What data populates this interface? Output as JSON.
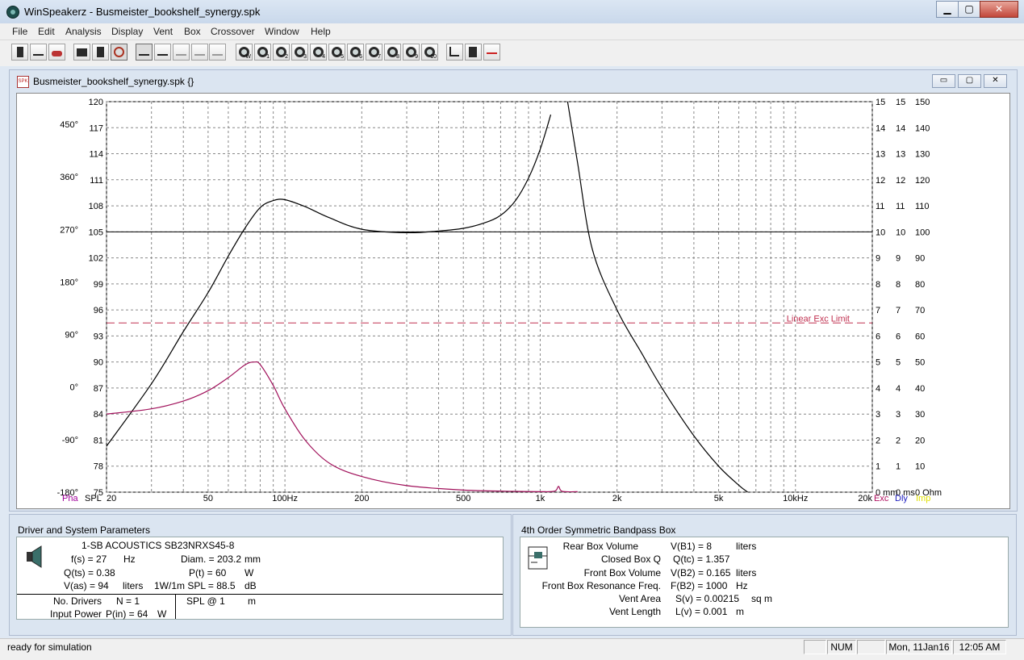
{
  "window": {
    "title": "WinSpeakerz - Busmeister_bookshelf_synergy.spk"
  },
  "menu": [
    "File",
    "Edit",
    "Analysis",
    "Display",
    "Vent",
    "Box",
    "Crossover",
    "Window",
    "Help"
  ],
  "toolbar": {
    "left_group": [
      "speaker-icon",
      "step-icon",
      "car-icon"
    ],
    "group2": [
      "bars-icon",
      "box-icon",
      "impedance-icon"
    ],
    "curve_group": [
      "curve-1-icon",
      "curve-2-icon",
      "curve-3-icon",
      "curve-4-icon"
    ],
    "driver_buttons": [
      "W",
      "1",
      "2",
      "3",
      "4",
      "5",
      "6",
      "7",
      "8",
      "9",
      "10"
    ],
    "right_group": [
      "graph-icon",
      "print-icon",
      "crossover-icon"
    ]
  },
  "document": {
    "title": "Busmeister_bookshelf_synergy.spk {}"
  },
  "chart_data": {
    "type": "line",
    "x_scale": "log",
    "xlim": [
      20,
      20000
    ],
    "x_ticks": [
      {
        "v": 20,
        "label": "20"
      },
      {
        "v": 50,
        "label": "50"
      },
      {
        "v": 100,
        "label": "100Hz"
      },
      {
        "v": 200,
        "label": "200"
      },
      {
        "v": 500,
        "label": "500"
      },
      {
        "v": 1000,
        "label": "1k"
      },
      {
        "v": 2000,
        "label": "2k"
      },
      {
        "v": 5000,
        "label": "5k"
      },
      {
        "v": 10000,
        "label": "10kHz"
      },
      {
        "v": 20000,
        "label": "20k"
      }
    ],
    "spl_ticks": [
      "120",
      "117",
      "114",
      "111",
      "108",
      "105",
      "102",
      "99",
      "96",
      "93",
      "90",
      "87",
      "84",
      "81",
      "78",
      "75"
    ],
    "spl_lim": [
      75,
      120
    ],
    "phase_ticks": [
      "450°",
      "360°",
      "270°",
      "180°",
      "90°",
      "0°",
      "-90°",
      "-180°"
    ],
    "exc_ticks": [
      "15",
      "14",
      "13",
      "12",
      "11",
      "10",
      "9",
      "8",
      "7",
      "6",
      "5",
      "4",
      "3",
      "2",
      "1",
      "0 mm"
    ],
    "dly_ticks": [
      "15",
      "14",
      "13",
      "12",
      "11",
      "10",
      "9",
      "8",
      "7",
      "6",
      "5",
      "4",
      "3",
      "2",
      "1",
      "0 ms"
    ],
    "imp_ticks": [
      "150",
      "140",
      "130",
      "120",
      "110",
      "100",
      "90",
      "80",
      "70",
      "60",
      "50",
      "40",
      "30",
      "20",
      "10",
      "0 Ohm"
    ],
    "left_labels": {
      "pha": "Pha",
      "spl": "SPL"
    },
    "right_labels": {
      "exc": "Exc",
      "dly": "Dly",
      "imp": "Imp"
    },
    "colors": {
      "spl": "#000000",
      "excursion": "#a0105a",
      "linear_limit": "#c03050",
      "pha_label": "#a0009a",
      "dly_label": "#2020c0",
      "imp_label": "#e0e000",
      "exc_label": "#b01060"
    },
    "reference_line_spl": 105,
    "linear_exc_limit": {
      "label": "Linear Exc Limit",
      "value_mm": 6.5
    },
    "series": [
      {
        "name": "SPL",
        "unit": "dB",
        "points": [
          [
            20,
            80.3
          ],
          [
            30,
            87.5
          ],
          [
            40,
            93.5
          ],
          [
            50,
            98
          ],
          [
            60,
            102.2
          ],
          [
            70,
            105.5
          ],
          [
            80,
            107.8
          ],
          [
            90,
            108.6
          ],
          [
            100,
            108.7
          ],
          [
            120,
            107.9
          ],
          [
            150,
            106.6
          ],
          [
            200,
            105.3
          ],
          [
            300,
            104.9
          ],
          [
            400,
            105.1
          ],
          [
            500,
            105.4
          ],
          [
            600,
            106.0
          ],
          [
            700,
            106.9
          ],
          [
            800,
            108.6
          ],
          [
            900,
            111.2
          ],
          [
            1000,
            114.5
          ],
          [
            1100,
            118.5
          ]
        ]
      },
      {
        "name": "SPL-upper",
        "unit": "dB",
        "points": [
          [
            1280,
            120
          ],
          [
            1400,
            113
          ],
          [
            1600,
            103
          ],
          [
            2000,
            96
          ],
          [
            2500,
            91
          ],
          [
            3000,
            87
          ],
          [
            4000,
            81.5
          ],
          [
            5000,
            78
          ],
          [
            6000,
            75.8
          ],
          [
            6500,
            75
          ]
        ]
      },
      {
        "name": "Excursion",
        "unit": "mm",
        "points": [
          [
            20,
            3.0
          ],
          [
            30,
            3.2
          ],
          [
            40,
            3.5
          ],
          [
            50,
            3.9
          ],
          [
            60,
            4.4
          ],
          [
            70,
            4.9
          ],
          [
            76,
            5.0
          ],
          [
            80,
            4.9
          ],
          [
            90,
            4.1
          ],
          [
            100,
            3.2
          ],
          [
            120,
            2.0
          ],
          [
            150,
            1.1
          ],
          [
            200,
            0.6
          ],
          [
            300,
            0.25
          ],
          [
            500,
            0.08
          ],
          [
            800,
            0.03
          ],
          [
            1000,
            0.02
          ],
          [
            1140,
            0.04
          ],
          [
            1180,
            0.22
          ],
          [
            1220,
            0.03
          ],
          [
            1400,
            0.02
          ]
        ]
      }
    ]
  },
  "driver_panel": {
    "title": "Driver and System Parameters",
    "driver_name": "1-SB ACOUSTICS  SB23NRXS45-8",
    "rows": [
      {
        "label": "f(s) = 27",
        "unit": "Hz",
        "label2": "Diam. = 203.2",
        "unit2": "mm"
      },
      {
        "label": "Q(ts) = 0.38",
        "unit": "",
        "label2": "P(t) = 60",
        "unit2": "W"
      },
      {
        "label": "V(as) = 94",
        "unit": "liters",
        "label2": "1W/1m SPL = 88.5",
        "unit2": "dB"
      }
    ],
    "no_drivers_label": "No. Drivers",
    "no_drivers_value": "N = 1",
    "input_power_label": "Input Power",
    "input_power_value": "P(in) = 64",
    "input_power_unit": "W",
    "spl_at_label": "SPL @ 1",
    "spl_at_unit": "m"
  },
  "box_panel": {
    "title": "4th Order Symmetric Bandpass Box",
    "rows": [
      {
        "name": "Rear Box Volume",
        "value": "V(B1) = 8",
        "unit": "liters"
      },
      {
        "name": "Closed Box Q",
        "value": "Q(tc) = 1.357",
        "unit": ""
      },
      {
        "name": "Front Box Volume",
        "value": "V(B2) = 0.165",
        "unit": "liters"
      },
      {
        "name": "Front Box Resonance Freq.",
        "value": "F(B2) = 1000",
        "unit": "Hz"
      },
      {
        "name": "Vent Area",
        "value": "S(v) = 0.00215",
        "unit": "sq m"
      },
      {
        "name": "Vent Length",
        "value": "L(v) = 0.001",
        "unit": "m"
      }
    ]
  },
  "status": {
    "message": "ready for simulation",
    "num": "NUM",
    "date": "Mon, 11Jan16",
    "time": "12:05  AM"
  }
}
